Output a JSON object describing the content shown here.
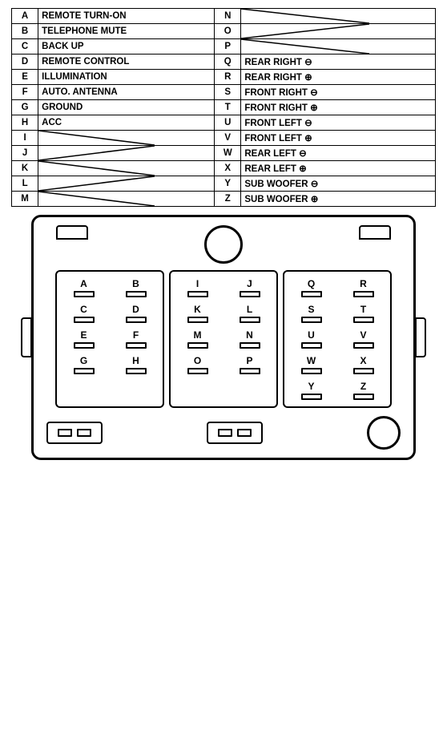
{
  "table": {
    "rows": [
      {
        "left_letter": "A",
        "left_label": "REMOTE TURN-ON",
        "right_letter": "N",
        "right_label": ""
      },
      {
        "left_letter": "B",
        "left_label": "TELEPHONE MUTE",
        "right_letter": "O",
        "right_label": ""
      },
      {
        "left_letter": "C",
        "left_label": "BACK UP",
        "right_letter": "P",
        "right_label": ""
      },
      {
        "left_letter": "D",
        "left_label": "REMOTE CONTROL",
        "right_letter": "Q",
        "right_label": "REAR RIGHT ⊖"
      },
      {
        "left_letter": "E",
        "left_label": "ILLUMINATION",
        "right_letter": "R",
        "right_label": "REAR RIGHT ⊕"
      },
      {
        "left_letter": "F",
        "left_label": "AUTO. ANTENNA",
        "right_letter": "S",
        "right_label": "FRONT RIGHT ⊖"
      },
      {
        "left_letter": "G",
        "left_label": "GROUND",
        "right_letter": "T",
        "right_label": "FRONT RIGHT ⊕"
      },
      {
        "left_letter": "H",
        "left_label": "ACC",
        "right_letter": "U",
        "right_label": "FRONT LEFT ⊖"
      },
      {
        "left_letter": "I",
        "left_label": "",
        "right_letter": "V",
        "right_label": "FRONT LEFT ⊕"
      },
      {
        "left_letter": "J",
        "left_label": "",
        "right_letter": "W",
        "right_label": "REAR LEFT ⊖"
      },
      {
        "left_letter": "K",
        "left_label": "",
        "right_letter": "X",
        "right_label": "REAR LEFT ⊕"
      },
      {
        "left_letter": "L",
        "left_label": "",
        "right_letter": "Y",
        "right_label": "SUB WOOFER ⊖"
      },
      {
        "left_letter": "M",
        "left_label": "",
        "right_letter": "Z",
        "right_label": "SUB WOOFER ⊕"
      }
    ]
  },
  "connector": {
    "left_block_pins": [
      "A",
      "B",
      "C",
      "D",
      "E",
      "F",
      "G",
      "H"
    ],
    "mid_block_pins": [
      "I",
      "J",
      "K",
      "L",
      "M",
      "N",
      "O",
      "P"
    ],
    "right_block_pins": [
      "Q",
      "R",
      "S",
      "T",
      "U",
      "V",
      "W",
      "X",
      "Y",
      "Z"
    ]
  }
}
